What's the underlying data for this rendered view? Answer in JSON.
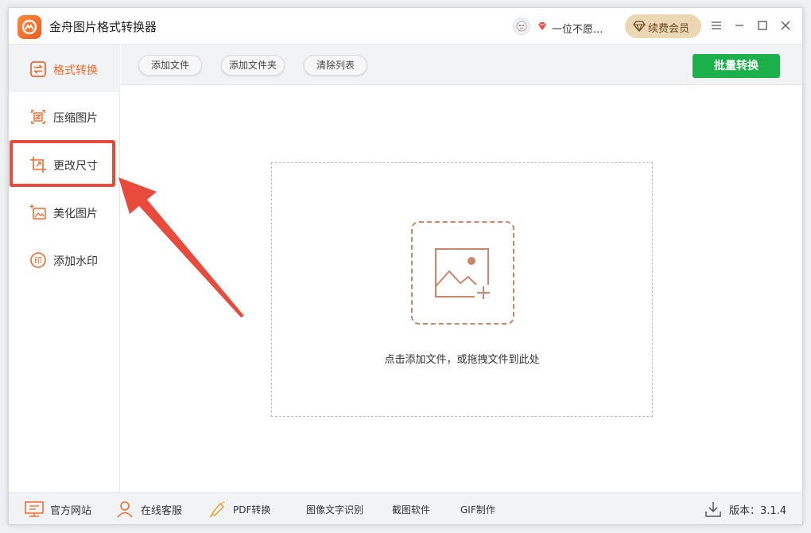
{
  "app": {
    "title": "金舟图片格式转换器",
    "user_name": "一位不愿...",
    "renew_label": "续费会员"
  },
  "sidebar": {
    "items": [
      {
        "label": "格式转换",
        "icon": "format-convert-icon",
        "active": true
      },
      {
        "label": "压缩图片",
        "icon": "compress-icon",
        "active": false
      },
      {
        "label": "更改尺寸",
        "icon": "resize-icon",
        "active": false
      },
      {
        "label": "美化图片",
        "icon": "beautify-icon",
        "active": false
      },
      {
        "label": "添加水印",
        "icon": "watermark-icon",
        "active": false
      }
    ]
  },
  "toolbar": {
    "add_file": "添加文件",
    "add_folder": "添加文件夹",
    "clear_list": "清除列表",
    "batch_convert": "批量转换"
  },
  "dropzone": {
    "hint": "点击添加文件，或拖拽文件到此处"
  },
  "statusbar": {
    "website": "官方网站",
    "support": "在线客服",
    "pdf": "PDF转换",
    "ocr": "图像文字识别",
    "screenshot": "截图软件",
    "gif": "GIF制作",
    "version": "版本：3.1.4"
  },
  "colors": {
    "accent": "#ef6a2f",
    "primary_green": "#1bb04a",
    "highlight_red": "#e84a3c",
    "vip_gold": "#ecd7b4"
  }
}
